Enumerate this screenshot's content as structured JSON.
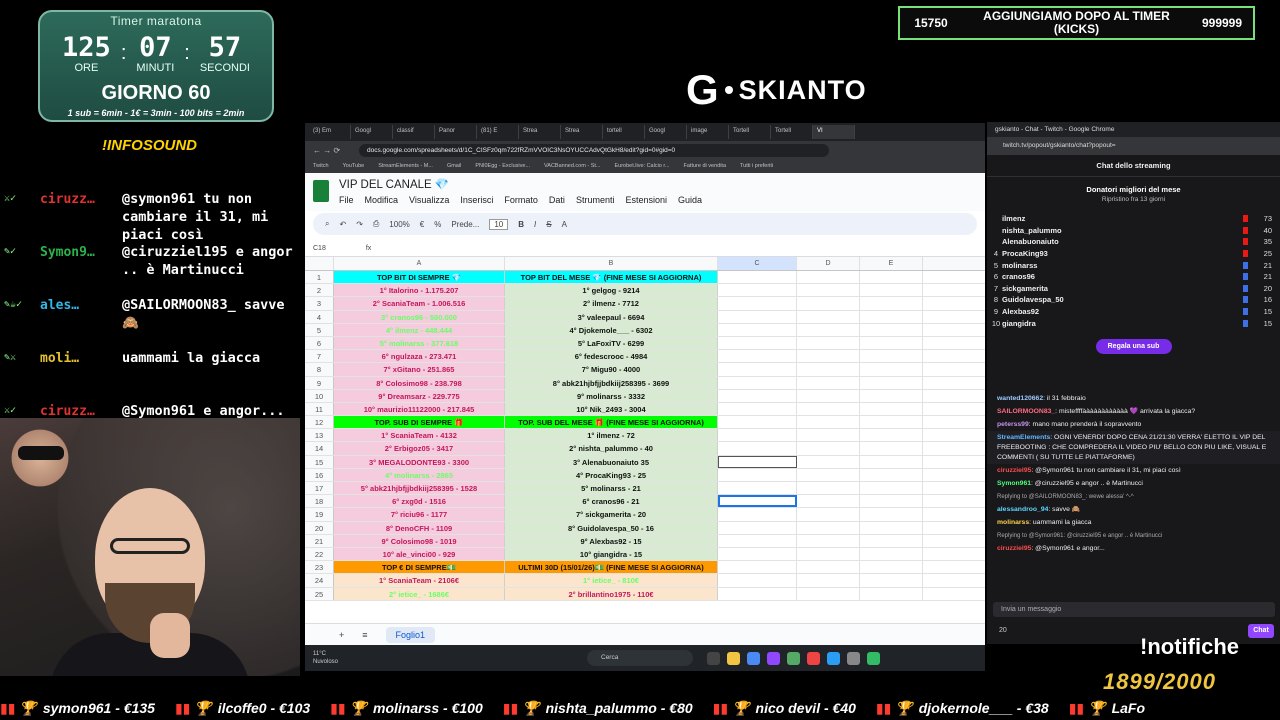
{
  "timer": {
    "title": "Timer maratona",
    "hours": "125",
    "minutes": "07",
    "seconds": "57",
    "hours_label": "ORE",
    "minutes_label": "MINUTI",
    "seconds_label": "SECONDI",
    "day": "GIORNO 60",
    "rates": "1 sub = 6min - 1€ = 3min - 100 bits = 2min"
  },
  "infosound": "!INFOSOUND",
  "overlay_chat": [
    {
      "user": "ciruzz…",
      "user_color": "#e0322f",
      "badges": "⚔✓",
      "message": "@symon961 tu non cambiare il 31, mi piaci così"
    },
    {
      "user": "Symon9…",
      "user_color": "#2db34a",
      "badges": "✎✓",
      "message": "@ciruzziel195 e angor .. è Martinucci"
    },
    {
      "user": "ales…",
      "user_color": "#2fb8e6",
      "badges": "✎☕✓",
      "message": "@SAILORMOON83_ savve 🙈"
    },
    {
      "user": "moli…",
      "user_color": "#e6c12f",
      "badges": "✎⚔",
      "message": "uammami la giacca"
    },
    {
      "user": "ciruzz…",
      "user_color": "#e0322f",
      "badges": "⚔✓",
      "message": "@Symon961 e angor..."
    }
  ],
  "donation_bar": {
    "left_value": "15750",
    "text": "AGGIUNGIAMO DOPO AL TIMER (KICKS)",
    "right_value": "999999"
  },
  "logo": {
    "mark": "G",
    "word": "SKIANTO"
  },
  "browser": {
    "tabs": [
      "(3) Em",
      "Googl",
      "classif",
      "Panor",
      "(81) E",
      "Strea",
      "Strea",
      "tortell",
      "Googl",
      "image",
      "Tortell",
      "Tortell",
      "VI"
    ],
    "url": "docs.google.com/spreadsheets/d/1C_CISFz0qm722fRZmVVOIC3NsOYUCCAdvQtGkH8/edit?gid=0#gid=0",
    "bookmarks": [
      "Twitch",
      "YouTube",
      "StreamElements - M...",
      "Gmail",
      "PNI0Egg - Exclusive...",
      "VACBanned.com - St...",
      "Eurobet.live: Calcio r...",
      "Fatture di vendita",
      "Tutti i preferiti"
    ]
  },
  "sheet": {
    "doc_title": "VIP DEL CANALE 💎",
    "menus": [
      "File",
      "Modifica",
      "Visualizza",
      "Inserisci",
      "Formato",
      "Dati",
      "Strumenti",
      "Estensioni",
      "Guida"
    ],
    "zoom": "100%",
    "font": "Prede...",
    "font_size": "10",
    "cell_ref": "C18",
    "fx": "fx",
    "columns": [
      "A",
      "B",
      "C",
      "D",
      "E"
    ],
    "rows": [
      {
        "n": "1",
        "a": "TOP BIT DI SEMPRE 💎",
        "b": "TOP BIT DEL MESE 💎 (FINE MESE SI AGGIORNA)",
        "bg_a": "#00ffff",
        "bg_b": "#00ffff",
        "fg_a": "#111",
        "fg_b": "#111"
      },
      {
        "n": "2",
        "a": "1° Italorino - 1.175.207",
        "b": "1° gelgog - 9214",
        "bg_a": "#f4ccdd",
        "bg_b": "#d9ead3",
        "fg_a": "#c2185b",
        "fg_b": "#111"
      },
      {
        "n": "3",
        "a": "2° ScaniaTeam - 1.006.516",
        "b": "2° ilmenz - 7712",
        "bg_a": "#f4ccdd",
        "bg_b": "#d9ead3",
        "fg_a": "#c2185b",
        "fg_b": "#111"
      },
      {
        "n": "4",
        "a": "3° cranos96 - 500.000",
        "b": "3° valeepaul - 6694",
        "bg_a": "#f4ccdd",
        "bg_b": "#d9ead3",
        "fg_a": "#6aff66",
        "fg_b": "#111"
      },
      {
        "n": "5",
        "a": "4° ilmenz - 448.444",
        "b": "4° Djokemole___ - 6302",
        "bg_a": "#f4ccdd",
        "bg_b": "#d9ead3",
        "fg_a": "#6aff66",
        "fg_b": "#111"
      },
      {
        "n": "6",
        "a": "5° molinarss - 377.618",
        "b": "5° LaFoxiTV - 6299",
        "bg_a": "#f4ccdd",
        "bg_b": "#d9ead3",
        "fg_a": "#6aff66",
        "fg_b": "#111"
      },
      {
        "n": "7",
        "a": "6° ngulzaza - 273.471",
        "b": "6° fedescrooc - 4984",
        "bg_a": "#f4ccdd",
        "bg_b": "#d9ead3",
        "fg_a": "#c2185b",
        "fg_b": "#111"
      },
      {
        "n": "8",
        "a": "7° xGitano - 251.865",
        "b": "7° Migu90 - 4000",
        "bg_a": "#f4ccdd",
        "bg_b": "#d9ead3",
        "fg_a": "#c2185b",
        "fg_b": "#111"
      },
      {
        "n": "9",
        "a": "8° Colosimo98 - 238.798",
        "b": "8° abk21hjbfjjbdkiij258395 - 3699",
        "bg_a": "#f4ccdd",
        "bg_b": "#d9ead3",
        "fg_a": "#c2185b",
        "fg_b": "#111"
      },
      {
        "n": "10",
        "a": "9° Dreamsarz - 229.775",
        "b": "9° molinarss - 3332",
        "bg_a": "#f4ccdd",
        "bg_b": "#d9ead3",
        "fg_a": "#c2185b",
        "fg_b": "#111"
      },
      {
        "n": "11",
        "a": "10° maurizio11122000 - 217.845",
        "b": "10° Nik_2493 - 3004",
        "bg_a": "#f4ccdd",
        "bg_b": "#d9ead3",
        "fg_a": "#c2185b",
        "fg_b": "#111"
      },
      {
        "n": "12",
        "a": "TOP. SUB DI SEMPRE 🎁",
        "b": "TOP. SUB DEL MESE 🎁 (FINE MESE SI AGGIORNA)",
        "bg_a": "#00ff00",
        "bg_b": "#00ff00",
        "fg_a": "#111",
        "fg_b": "#111"
      },
      {
        "n": "13",
        "a": "1° ScaniaTeam - 4132",
        "b": "1° ilmenz - 72",
        "bg_a": "#f4ccdd",
        "bg_b": "#d9ead3",
        "fg_a": "#c2185b",
        "fg_b": "#111"
      },
      {
        "n": "14",
        "a": "2° Erbigoz05 - 3417",
        "b": "2° nishta_palummo - 40",
        "bg_a": "#f4ccdd",
        "bg_b": "#d9ead3",
        "fg_a": "#c2185b",
        "fg_b": "#111"
      },
      {
        "n": "15",
        "a": "3° MEGALODONTE93 - 3300",
        "b": "3° Alenabuonaiuto 35",
        "bg_a": "#f4ccdd",
        "bg_b": "#d9ead3",
        "fg_a": "#c2185b",
        "fg_b": "#111"
      },
      {
        "n": "16",
        "a": "4° molinarss - 2865",
        "b": "4° ProcaKing93 - 25",
        "bg_a": "#f4ccdd",
        "bg_b": "#d9ead3",
        "fg_a": "#6aff66",
        "fg_b": "#111"
      },
      {
        "n": "17",
        "a": "5° abk21hjbfjjbdkiij258395 - 1528",
        "b": "5° molinarss - 21",
        "bg_a": "#f4ccdd",
        "bg_b": "#d9ead3",
        "fg_a": "#c2185b",
        "fg_b": "#111"
      },
      {
        "n": "18",
        "a": "6° zxg0d - 1516",
        "b": "6° cranos96 - 21",
        "bg_a": "#f4ccdd",
        "bg_b": "#d9ead3",
        "fg_a": "#c2185b",
        "fg_b": "#111"
      },
      {
        "n": "19",
        "a": "7° riciu96 - 1177",
        "b": "7° sickgamerita - 20",
        "bg_a": "#f4ccdd",
        "bg_b": "#d9ead3",
        "fg_a": "#c2185b",
        "fg_b": "#111"
      },
      {
        "n": "20",
        "a": "8° DenoCFH - 1109",
        "b": "8° Guidolavespa_50 - 16",
        "bg_a": "#f4ccdd",
        "bg_b": "#d9ead3",
        "fg_a": "#c2185b",
        "fg_b": "#111"
      },
      {
        "n": "21",
        "a": "9° Colosimo98 - 1019",
        "b": "9° Alexbas92 - 15",
        "bg_a": "#f4ccdd",
        "bg_b": "#d9ead3",
        "fg_a": "#c2185b",
        "fg_b": "#111"
      },
      {
        "n": "22",
        "a": "10° ale_vinci00 - 929",
        "b": "10° giangidra - 15",
        "bg_a": "#f4ccdd",
        "bg_b": "#d9ead3",
        "fg_a": "#c2185b",
        "fg_b": "#111"
      },
      {
        "n": "23",
        "a": "TOP € DI SEMPRE💵",
        "b": "ULTIMI 30D (15/01/26)💵 (FINE MESE SI AGGIORNA)",
        "bg_a": "#ff9900",
        "bg_b": "#ff9900",
        "fg_a": "#111",
        "fg_b": "#111"
      },
      {
        "n": "24",
        "a": "1° ScaniaTeam - 2106€",
        "b": "1° ietice_ - 810€",
        "bg_a": "#fce5cd",
        "bg_b": "#fce5cd",
        "fg_a": "#c2185b",
        "fg_b": "#6aff66"
      },
      {
        "n": "25",
        "a": "2° ietice_ - 1686€",
        "b": "2° brillantino1975 - 110€",
        "bg_a": "#fce5cd",
        "bg_b": "#fce5cd",
        "fg_a": "#6aff66",
        "fg_b": "#c2185b"
      }
    ],
    "sheet_tab": "Foglio1"
  },
  "twitch": {
    "window_title": "gskianto - Chat - Twitch - Google Chrome",
    "url": "twitch.tv/popout/gskianto/chat?popout=",
    "header": "Chat dello streaming",
    "donors_title": "Donatori migliori del mese",
    "donors_sub": "Ripristino fra 13 giorni",
    "donors": [
      {
        "rank": "",
        "name": "ilmenz",
        "value": "73",
        "color": "#e91916"
      },
      {
        "rank": "",
        "name": "nishta_palummo",
        "value": "40",
        "color": "#e91916"
      },
      {
        "rank": "",
        "name": "Alenabuonaiuto",
        "value": "35",
        "color": "#e91916"
      },
      {
        "rank": "4",
        "name": "ProcaKing93",
        "value": "25",
        "color": "#e91916"
      },
      {
        "rank": "5",
        "name": "molinarss",
        "value": "21",
        "color": "#3d6fe6"
      },
      {
        "rank": "6",
        "name": "cranos96",
        "value": "21",
        "color": "#3d6fe6"
      },
      {
        "rank": "7",
        "name": "sickgamerita",
        "value": "20",
        "color": "#3d6fe6"
      },
      {
        "rank": "8",
        "name": "Guidolavespa_50",
        "value": "16",
        "color": "#3d6fe6"
      },
      {
        "rank": "9",
        "name": "Alexbas92",
        "value": "15",
        "color": "#3d6fe6"
      },
      {
        "rank": "10",
        "name": "giangidra",
        "value": "15",
        "color": "#3d6fe6"
      }
    ],
    "gift_label": "Regala una sub",
    "messages": [
      {
        "user": "wanted120662",
        "color": "#9ecbff",
        "text": ": il 31 febbraio",
        "type": "msg"
      },
      {
        "user": "SAILORMOON83_",
        "color": "#ff6b81",
        "text": ": misteffffàààààààààààà 💜 arrivata la giacca?",
        "type": "msg"
      },
      {
        "user": "peterss99",
        "color": "#c792ea",
        "text": ": mano mano prenderà il sopravvento",
        "type": "msg"
      },
      {
        "user": "StreamElements",
        "color": "#5fb8ff",
        "text": ": OGNI VENERDI' DOPO CENA 21/21:30 VERRA' ELETTO IL VIP DEL FREEBOOTING : CHE COMPREDERA IL VIDEO PIU' BELLO CON PIU LIKE, VISUAL E COMMENTI ( SU TUTTE LE PIATTAFORME)",
        "type": "hl"
      },
      {
        "user": "ciruzziel95",
        "color": "#ff4d4d",
        "text": ": @Symon961 tu non cambiare il 31, mi piaci così",
        "type": "msg"
      },
      {
        "user": "Symon961",
        "color": "#4dff7a",
        "text": ": @ciruzziel95 e angor .. è Martinucci",
        "type": "msg"
      },
      {
        "user": "",
        "color": "#aaa",
        "text": "Replying to @SAILORMOON83_: wewe alessa' ^-^",
        "type": "reply"
      },
      {
        "user": "alessandroo_94",
        "color": "#5fd6ff",
        "text": ": savve 🙈",
        "type": "msg"
      },
      {
        "user": "molinarss",
        "color": "#ffd24d",
        "text": ": uammami la giacca",
        "type": "msg"
      },
      {
        "user": "",
        "color": "#aaa",
        "text": "Replying to @Symon961: @ciruzziel95 e angor .. è Martinucci",
        "type": "reply"
      },
      {
        "user": "ciruzziel95",
        "color": "#ff4d4d",
        "text": ": @Symon961 e angor...",
        "type": "msg"
      }
    ],
    "input_placeholder": "Invia un messaggio",
    "points": "20",
    "chat_button": "Chat"
  },
  "taskbar": {
    "weather_temp": "11°C",
    "weather_desc": "Nuvoloso",
    "search": "Cerca"
  },
  "notifiche": "!notifiche",
  "subcount": "1899/2000",
  "ticker": [
    {
      "text": "symon961 - €135"
    },
    {
      "text": "ilcoffe0 - €103"
    },
    {
      "text": "molinarss - €100"
    },
    {
      "text": "nishta_palummo - €80"
    },
    {
      "text": "nico devil - €40"
    },
    {
      "text": "djokernole___ - €38"
    },
    {
      "text": "LaFo"
    }
  ]
}
